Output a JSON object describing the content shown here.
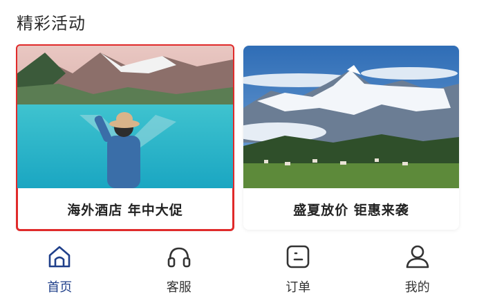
{
  "section": {
    "title": "精彩活动"
  },
  "cards": [
    {
      "label": "海外酒店  年中大促",
      "image": "lake-traveler-photo",
      "selected": true
    },
    {
      "label": "盛夏放价  钜惠来袭",
      "image": "snow-mountain-photo",
      "selected": false
    }
  ],
  "tabbar": {
    "items": [
      {
        "label": "首页",
        "icon": "home-icon",
        "active": true
      },
      {
        "label": "客服",
        "icon": "headset-icon",
        "active": false
      },
      {
        "label": "订单",
        "icon": "order-icon",
        "active": false
      },
      {
        "label": "我的",
        "icon": "user-icon",
        "active": false
      }
    ],
    "active_color": "#1f3f8a",
    "icon_color": "#333333"
  },
  "colors": {
    "selection_outline": "#e02a2a"
  }
}
